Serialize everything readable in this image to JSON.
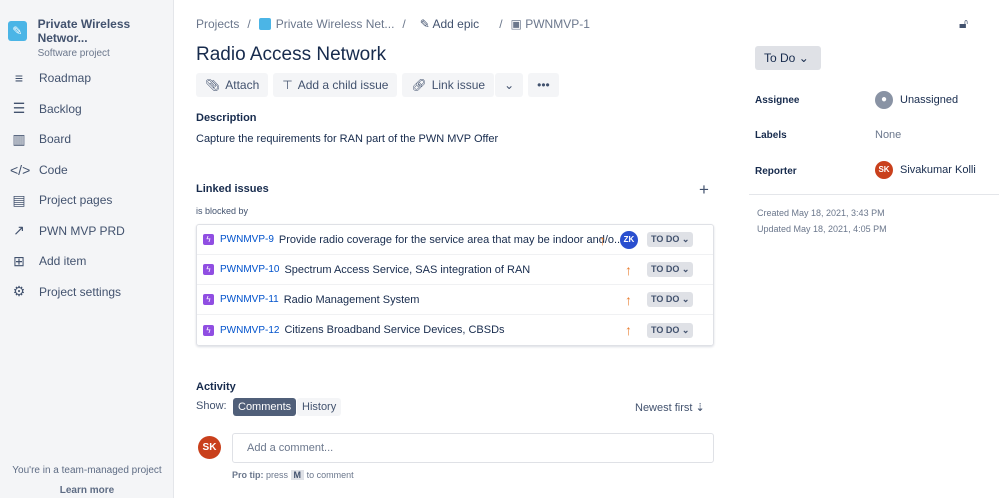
{
  "sidebar": {
    "project_name": "Private Wireless Networ...",
    "project_type": "Software project",
    "items": [
      {
        "label": "Roadmap",
        "icon": "≡"
      },
      {
        "label": "Backlog",
        "icon": "☰"
      },
      {
        "label": "Board",
        "icon": "▥"
      },
      {
        "label": "Code",
        "icon": "</>"
      },
      {
        "label": "Project pages",
        "icon": "▤"
      },
      {
        "label": "PWN MVP PRD",
        "icon": "↗"
      },
      {
        "label": "Add item",
        "icon": "⊞"
      },
      {
        "label": "Project settings",
        "icon": "⚙"
      }
    ],
    "footer_text": "You're in a team-managed project",
    "learn_more": "Learn more"
  },
  "breadcrumb": {
    "projects": "Projects",
    "project": "Private Wireless Net...",
    "add_epic": "Add epic",
    "issue_key": "PWNMVP-1"
  },
  "issue": {
    "title": "Radio Access Network",
    "toolbar": {
      "attach": "Attach",
      "add_child": "Add a child issue",
      "link_issue": "Link issue"
    },
    "description_label": "Description",
    "description": "Capture the requirements for RAN part of the PWN MVP Offer",
    "linked_label": "Linked issues",
    "relation": "is blocked by",
    "linked": [
      {
        "key": "PWNMVP-9",
        "summary": "Provide radio coverage for the service area that may be indoor and/o...",
        "assignee": "ZK",
        "status": "TO DO"
      },
      {
        "key": "PWNMVP-10",
        "summary": "Spectrum Access Service, SAS integration of RAN",
        "assignee": "",
        "status": "TO DO"
      },
      {
        "key": "PWNMVP-11",
        "summary": "Radio Management System",
        "assignee": "",
        "status": "TO DO"
      },
      {
        "key": "PWNMVP-12",
        "summary": "Citizens Broadband Service Devices, CBSDs",
        "assignee": "",
        "status": "TO DO"
      }
    ],
    "activity": {
      "label": "Activity",
      "show": "Show:",
      "comments": "Comments",
      "history": "History",
      "sort": "Newest first",
      "user": "SK",
      "placeholder": "Add a comment...",
      "tip_bold": "Pro tip:",
      "tip_press": "press",
      "tip_key": "M",
      "tip_rest": "to comment"
    }
  },
  "details": {
    "status": "To Do",
    "assignee_label": "Assignee",
    "assignee": "Unassigned",
    "labels_label": "Labels",
    "labels": "None",
    "reporter_label": "Reporter",
    "reporter_initials": "SK",
    "reporter": "Sivakumar Kolli",
    "created": "Created May 18, 2021, 3:43 PM",
    "updated": "Updated May 18, 2021, 4:05 PM"
  },
  "colors": {
    "link": "#0052cc",
    "epic": "#904ee2",
    "priority": "#e97f33",
    "avatar_sk": "#c9401c",
    "avatar_zk": "#2a4fcf"
  }
}
